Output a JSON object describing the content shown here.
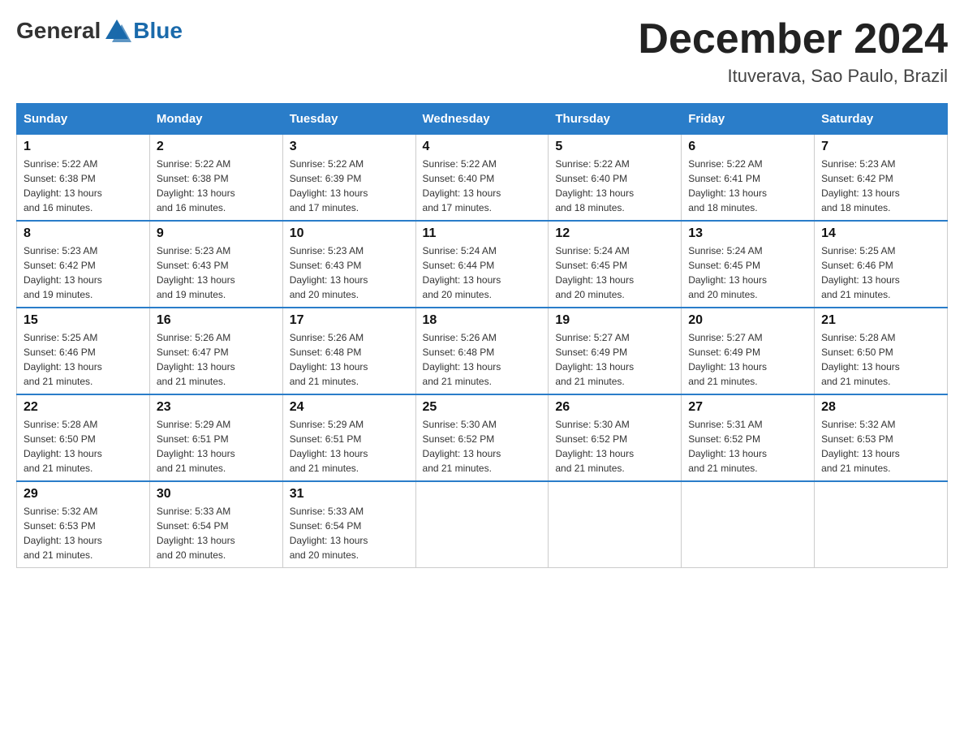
{
  "header": {
    "logo_text_general": "General",
    "logo_text_blue": "Blue",
    "month_year": "December 2024",
    "location": "Ituverava, Sao Paulo, Brazil"
  },
  "days_of_week": [
    "Sunday",
    "Monday",
    "Tuesday",
    "Wednesday",
    "Thursday",
    "Friday",
    "Saturday"
  ],
  "weeks": [
    [
      {
        "day": "1",
        "sunrise": "5:22 AM",
        "sunset": "6:38 PM",
        "daylight": "13 hours and 16 minutes."
      },
      {
        "day": "2",
        "sunrise": "5:22 AM",
        "sunset": "6:38 PM",
        "daylight": "13 hours and 16 minutes."
      },
      {
        "day": "3",
        "sunrise": "5:22 AM",
        "sunset": "6:39 PM",
        "daylight": "13 hours and 17 minutes."
      },
      {
        "day": "4",
        "sunrise": "5:22 AM",
        "sunset": "6:40 PM",
        "daylight": "13 hours and 17 minutes."
      },
      {
        "day": "5",
        "sunrise": "5:22 AM",
        "sunset": "6:40 PM",
        "daylight": "13 hours and 18 minutes."
      },
      {
        "day": "6",
        "sunrise": "5:22 AM",
        "sunset": "6:41 PM",
        "daylight": "13 hours and 18 minutes."
      },
      {
        "day": "7",
        "sunrise": "5:23 AM",
        "sunset": "6:42 PM",
        "daylight": "13 hours and 18 minutes."
      }
    ],
    [
      {
        "day": "8",
        "sunrise": "5:23 AM",
        "sunset": "6:42 PM",
        "daylight": "13 hours and 19 minutes."
      },
      {
        "day": "9",
        "sunrise": "5:23 AM",
        "sunset": "6:43 PM",
        "daylight": "13 hours and 19 minutes."
      },
      {
        "day": "10",
        "sunrise": "5:23 AM",
        "sunset": "6:43 PM",
        "daylight": "13 hours and 20 minutes."
      },
      {
        "day": "11",
        "sunrise": "5:24 AM",
        "sunset": "6:44 PM",
        "daylight": "13 hours and 20 minutes."
      },
      {
        "day": "12",
        "sunrise": "5:24 AM",
        "sunset": "6:45 PM",
        "daylight": "13 hours and 20 minutes."
      },
      {
        "day": "13",
        "sunrise": "5:24 AM",
        "sunset": "6:45 PM",
        "daylight": "13 hours and 20 minutes."
      },
      {
        "day": "14",
        "sunrise": "5:25 AM",
        "sunset": "6:46 PM",
        "daylight": "13 hours and 21 minutes."
      }
    ],
    [
      {
        "day": "15",
        "sunrise": "5:25 AM",
        "sunset": "6:46 PM",
        "daylight": "13 hours and 21 minutes."
      },
      {
        "day": "16",
        "sunrise": "5:26 AM",
        "sunset": "6:47 PM",
        "daylight": "13 hours and 21 minutes."
      },
      {
        "day": "17",
        "sunrise": "5:26 AM",
        "sunset": "6:48 PM",
        "daylight": "13 hours and 21 minutes."
      },
      {
        "day": "18",
        "sunrise": "5:26 AM",
        "sunset": "6:48 PM",
        "daylight": "13 hours and 21 minutes."
      },
      {
        "day": "19",
        "sunrise": "5:27 AM",
        "sunset": "6:49 PM",
        "daylight": "13 hours and 21 minutes."
      },
      {
        "day": "20",
        "sunrise": "5:27 AM",
        "sunset": "6:49 PM",
        "daylight": "13 hours and 21 minutes."
      },
      {
        "day": "21",
        "sunrise": "5:28 AM",
        "sunset": "6:50 PM",
        "daylight": "13 hours and 21 minutes."
      }
    ],
    [
      {
        "day": "22",
        "sunrise": "5:28 AM",
        "sunset": "6:50 PM",
        "daylight": "13 hours and 21 minutes."
      },
      {
        "day": "23",
        "sunrise": "5:29 AM",
        "sunset": "6:51 PM",
        "daylight": "13 hours and 21 minutes."
      },
      {
        "day": "24",
        "sunrise": "5:29 AM",
        "sunset": "6:51 PM",
        "daylight": "13 hours and 21 minutes."
      },
      {
        "day": "25",
        "sunrise": "5:30 AM",
        "sunset": "6:52 PM",
        "daylight": "13 hours and 21 minutes."
      },
      {
        "day": "26",
        "sunrise": "5:30 AM",
        "sunset": "6:52 PM",
        "daylight": "13 hours and 21 minutes."
      },
      {
        "day": "27",
        "sunrise": "5:31 AM",
        "sunset": "6:52 PM",
        "daylight": "13 hours and 21 minutes."
      },
      {
        "day": "28",
        "sunrise": "5:32 AM",
        "sunset": "6:53 PM",
        "daylight": "13 hours and 21 minutes."
      }
    ],
    [
      {
        "day": "29",
        "sunrise": "5:32 AM",
        "sunset": "6:53 PM",
        "daylight": "13 hours and 21 minutes."
      },
      {
        "day": "30",
        "sunrise": "5:33 AM",
        "sunset": "6:54 PM",
        "daylight": "13 hours and 20 minutes."
      },
      {
        "day": "31",
        "sunrise": "5:33 AM",
        "sunset": "6:54 PM",
        "daylight": "13 hours and 20 minutes."
      },
      null,
      null,
      null,
      null
    ]
  ]
}
